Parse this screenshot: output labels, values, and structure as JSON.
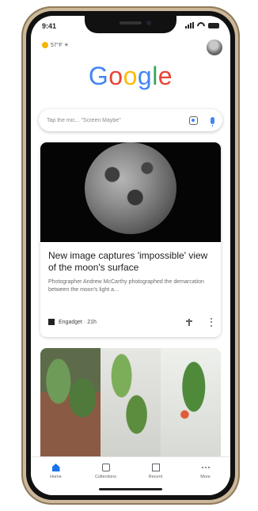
{
  "status": {
    "time": "9:41"
  },
  "weather": {
    "temp": "57°F ☀",
    "icon": "sun-icon"
  },
  "logo": {
    "letters": [
      "G",
      "o",
      "o",
      "g",
      "l",
      "e"
    ],
    "colors": [
      "#4285f4",
      "#ea4335",
      "#fbbc05",
      "#4285f4",
      "#34a853",
      "#ea4335"
    ]
  },
  "search": {
    "placeholder": "Tap the mic... \"Screen Maybe\""
  },
  "article": {
    "title": "New image captures 'impossible' view of the moon's surface",
    "snippet": "Photographer Andrew McCarthy photographed the demarcation between the moon's light a...",
    "source": "Engadget · 21h"
  },
  "bottom_nav": [
    {
      "label": "Home",
      "icon": "home-icon"
    },
    {
      "label": "Collections",
      "icon": "collections-icon"
    },
    {
      "label": "Recent",
      "icon": "recent-icon"
    },
    {
      "label": "More",
      "icon": "more-icon"
    }
  ]
}
